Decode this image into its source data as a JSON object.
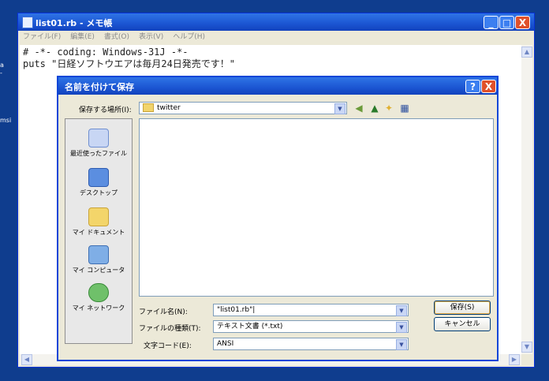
{
  "desktop": {
    "fragments": [
      "a",
      "-",
      "msi"
    ]
  },
  "notepad": {
    "title": "list01.rb - メモ帳",
    "menu": [
      "ファイル(F)",
      "編集(E)",
      "書式(O)",
      "表示(V)",
      "ヘルプ(H)"
    ],
    "lines": [
      "# -*- coding: Windows-31J -*-",
      "puts \"日経ソフトウエアは毎月24日発売です！\""
    ],
    "window_buttons": {
      "minimize": "_",
      "maximize": "□",
      "close": "X"
    }
  },
  "save_dialog": {
    "title": "名前を付けて保存",
    "help_button": "?",
    "close_button": "X",
    "save_in_label": "保存する場所(I):",
    "save_in_value": "twitter",
    "places": [
      {
        "icon": "recent-documents-icon",
        "label": "最近使ったファイル"
      },
      {
        "icon": "desktop-icon",
        "label": "デスクトップ"
      },
      {
        "icon": "my-documents-icon",
        "label": "マイ ドキュメント"
      },
      {
        "icon": "my-computer-icon",
        "label": "マイ コンピュータ"
      },
      {
        "icon": "my-network-icon",
        "label": "マイ ネットワーク"
      }
    ],
    "filename_label": "ファイル名(N):",
    "filename_value": "\"list01.rb\"|",
    "filetype_label": "ファイルの種類(T):",
    "filetype_value": "テキスト文書 (*.txt)",
    "encoding_label": "文字コード(E):",
    "encoding_value": "ANSI",
    "save_button": "保存(S)",
    "cancel_button": "キャンセル",
    "colors": {
      "title_bar": "#1b55d2",
      "close": "#e0502a",
      "face": "#ece9d8"
    }
  }
}
